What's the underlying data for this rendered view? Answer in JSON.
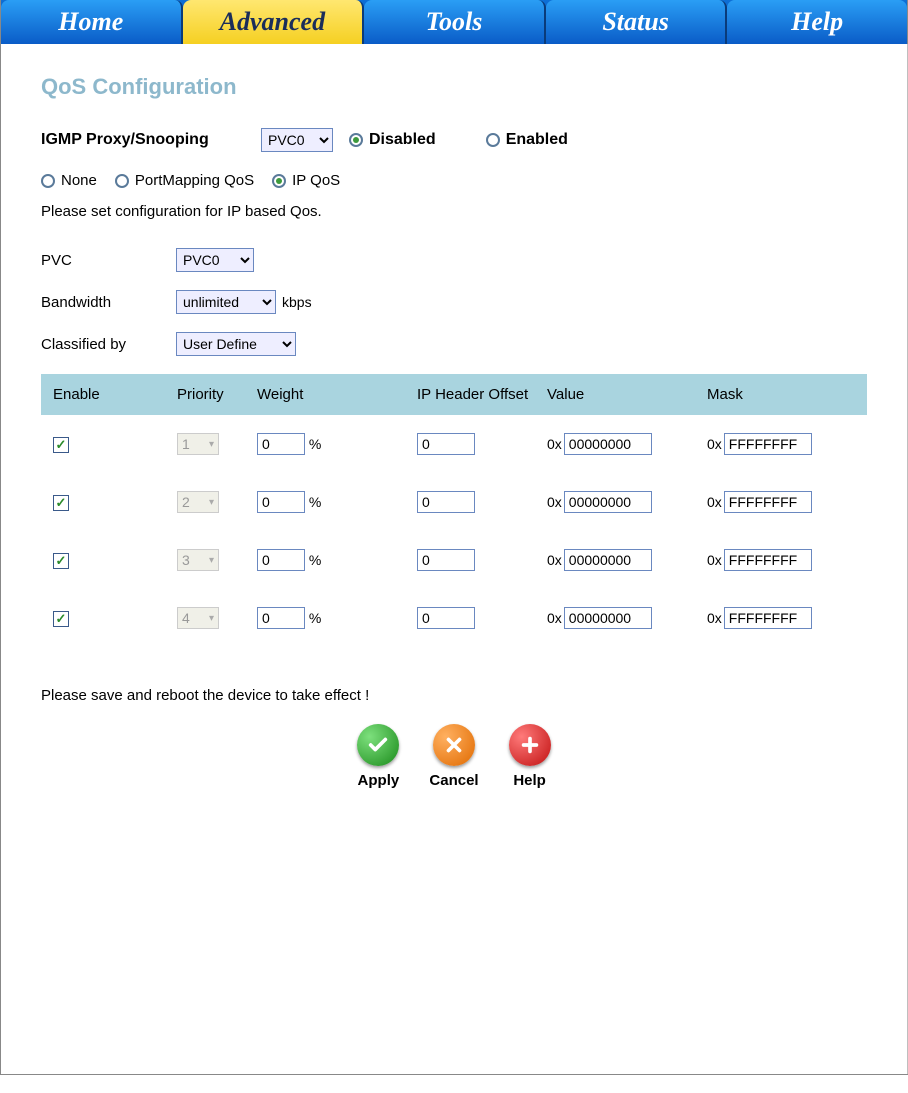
{
  "tabs": {
    "items": [
      {
        "label": "Home",
        "active": false
      },
      {
        "label": "Advanced",
        "active": true
      },
      {
        "label": "Tools",
        "active": false
      },
      {
        "label": "Status",
        "active": false
      },
      {
        "label": "Help",
        "active": false
      }
    ]
  },
  "page_title": "QoS Configuration",
  "igmp": {
    "label": "IGMP Proxy/Snooping",
    "pvc_selected": "PVC0",
    "disabled_label": "Disabled",
    "enabled_label": "Enabled",
    "selected": "disabled"
  },
  "mode": {
    "options": [
      {
        "label": "None",
        "selected": false
      },
      {
        "label": "PortMapping QoS",
        "selected": false
      },
      {
        "label": "IP QoS",
        "selected": true
      }
    ]
  },
  "instruction": "Please set configuration for IP based Qos.",
  "pvc": {
    "label": "PVC",
    "selected": "PVC0"
  },
  "bandwidth": {
    "label": "Bandwidth",
    "selected": "unlimited",
    "unit": "kbps"
  },
  "classified": {
    "label": "Classified by",
    "selected": "User Define"
  },
  "table": {
    "headers": {
      "enable": "Enable",
      "priority": "Priority",
      "weight": "Weight",
      "offset": "IP Header Offset",
      "value": "Value",
      "mask": "Mask"
    },
    "weight_unit": "%",
    "hex_prefix": "0x",
    "rows": [
      {
        "enabled": true,
        "priority": "1",
        "weight": "0",
        "offset": "0",
        "value": "00000000",
        "mask": "FFFFFFFF"
      },
      {
        "enabled": true,
        "priority": "2",
        "weight": "0",
        "offset": "0",
        "value": "00000000",
        "mask": "FFFFFFFF"
      },
      {
        "enabled": true,
        "priority": "3",
        "weight": "0",
        "offset": "0",
        "value": "00000000",
        "mask": "FFFFFFFF"
      },
      {
        "enabled": true,
        "priority": "4",
        "weight": "0",
        "offset": "0",
        "value": "00000000",
        "mask": "FFFFFFFF"
      }
    ]
  },
  "reboot_hint": "Please save and reboot the device to take effect !",
  "buttons": {
    "apply": "Apply",
    "cancel": "Cancel",
    "help": "Help"
  }
}
